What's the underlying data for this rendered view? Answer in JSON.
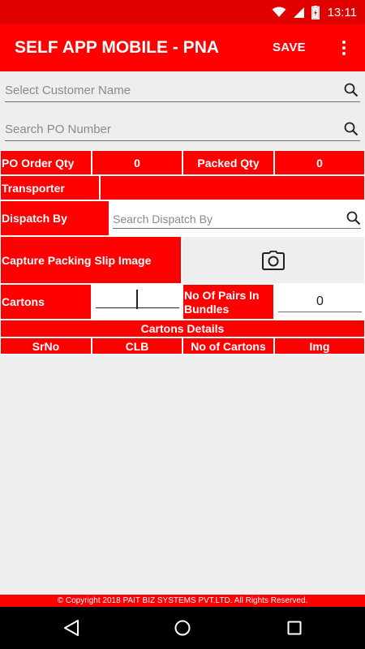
{
  "status_bar": {
    "time": "13:11",
    "icons": [
      "wifi-icon",
      "signal-icon",
      "battery-charging-icon"
    ]
  },
  "app_bar": {
    "title": "SELF APP MOBILE - PNA",
    "save_label": "SAVE",
    "menu_icon": "more-vert-icon"
  },
  "customer_search": {
    "placeholder": "Select Customer Name",
    "value": ""
  },
  "po_search": {
    "placeholder": "Search PO Number",
    "value": ""
  },
  "form": {
    "po_order_qty_label": "PO Order Qty",
    "po_order_qty_value": "0",
    "packed_qty_label": "Packed Qty",
    "packed_qty_value": "0",
    "transporter_label": "Transporter",
    "transporter_value": "",
    "dispatch_by_label": "Dispatch By",
    "dispatch_by_placeholder": "Search Dispatch By",
    "capture_label": "Capture Packing Slip Image",
    "camera_icon": "camera-icon",
    "cartons_label": "Cartons",
    "cartons_value": "",
    "pairs_label": "No Of Pairs In Bundles",
    "pairs_value": "0"
  },
  "cartons_table": {
    "title": "Cartons Details",
    "columns": [
      "SrNo",
      "CLB",
      "No of Cartons",
      "Img"
    ],
    "rows": []
  },
  "footer": {
    "copyright": "© Copyright 2018 PAIT BIZ SYSTEMS PVT.LTD. All Rights Reserved."
  },
  "colors": {
    "primary": "#ff0000",
    "status_bar": "#e00000",
    "background": "#eeeeee",
    "nav_bar": "#000000"
  }
}
